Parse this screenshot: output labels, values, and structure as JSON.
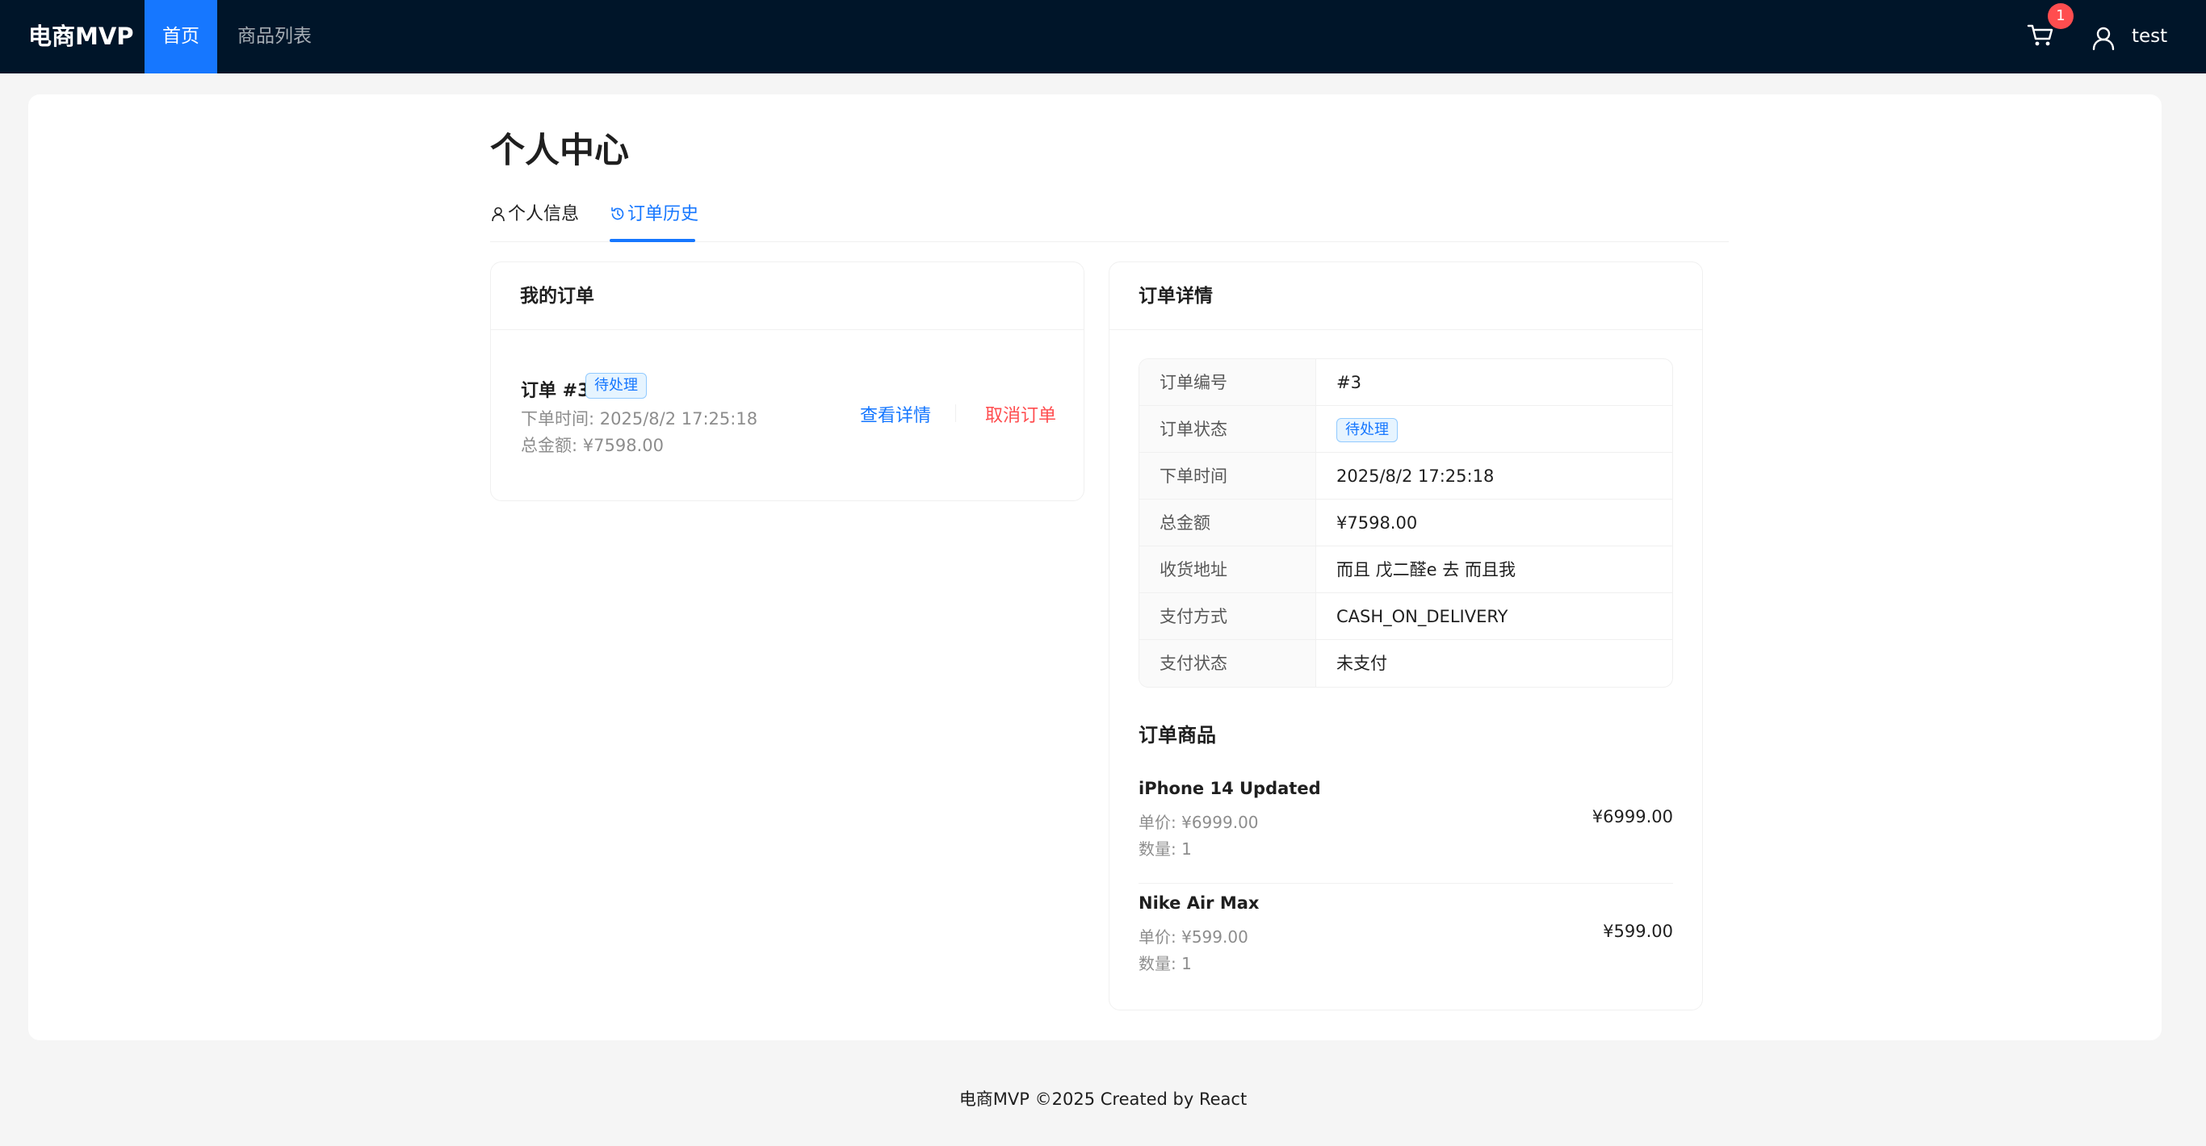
{
  "header": {
    "logo": "电商MVP",
    "nav": [
      {
        "label": "首页",
        "active": true
      },
      {
        "label": "商品列表",
        "active": false
      }
    ],
    "cart": {
      "icon": "shopping-cart-icon",
      "badge_count": "1"
    },
    "user": {
      "icon": "user-icon",
      "name": "test"
    }
  },
  "page": {
    "title": "个人中心",
    "tabs": [
      {
        "label": "个人信息",
        "icon": "user-icon",
        "active": false
      },
      {
        "label": "订单历史",
        "icon": "history-icon",
        "active": true
      }
    ]
  },
  "orders": {
    "title": "我的订单",
    "list": [
      {
        "title": "订单 #3",
        "status": "待处理",
        "time": "下单时间: 2025/8/2 17:25:18",
        "total": "总金额: ¥7598.00",
        "view_label": "查看详情",
        "cancel_label": "取消订单"
      }
    ]
  },
  "detail": {
    "title": "订单详情",
    "rows": [
      {
        "label": "订单编号",
        "value": "#3"
      },
      {
        "label": "订单状态",
        "value": "待处理"
      },
      {
        "label": "下单时间",
        "value": "2025/8/2 17:25:18"
      },
      {
        "label": "总金额",
        "value": "¥7598.00"
      },
      {
        "label": "收货地址",
        "value": "而且 戊二醛e 去 而且我"
      },
      {
        "label": "支付方式",
        "value": "CASH_ON_DELIVERY"
      },
      {
        "label": "支付状态",
        "value": "未支付"
      }
    ],
    "items_title": "订单商品",
    "items": [
      {
        "name": "iPhone 14 Updated",
        "unit_price": "单价: ¥6999.00",
        "quantity": "数量: 1",
        "subtotal": "¥6999.00"
      },
      {
        "name": "Nike Air Max",
        "unit_price": "单价: ¥599.00",
        "quantity": "数量: 1",
        "subtotal": "¥599.00"
      }
    ]
  },
  "footer": {
    "text": "电商MVP ©2025 Created by React"
  },
  "colors": {
    "header_bg": "#001529",
    "primary": "#1677ff",
    "danger": "#ff4d4f"
  }
}
